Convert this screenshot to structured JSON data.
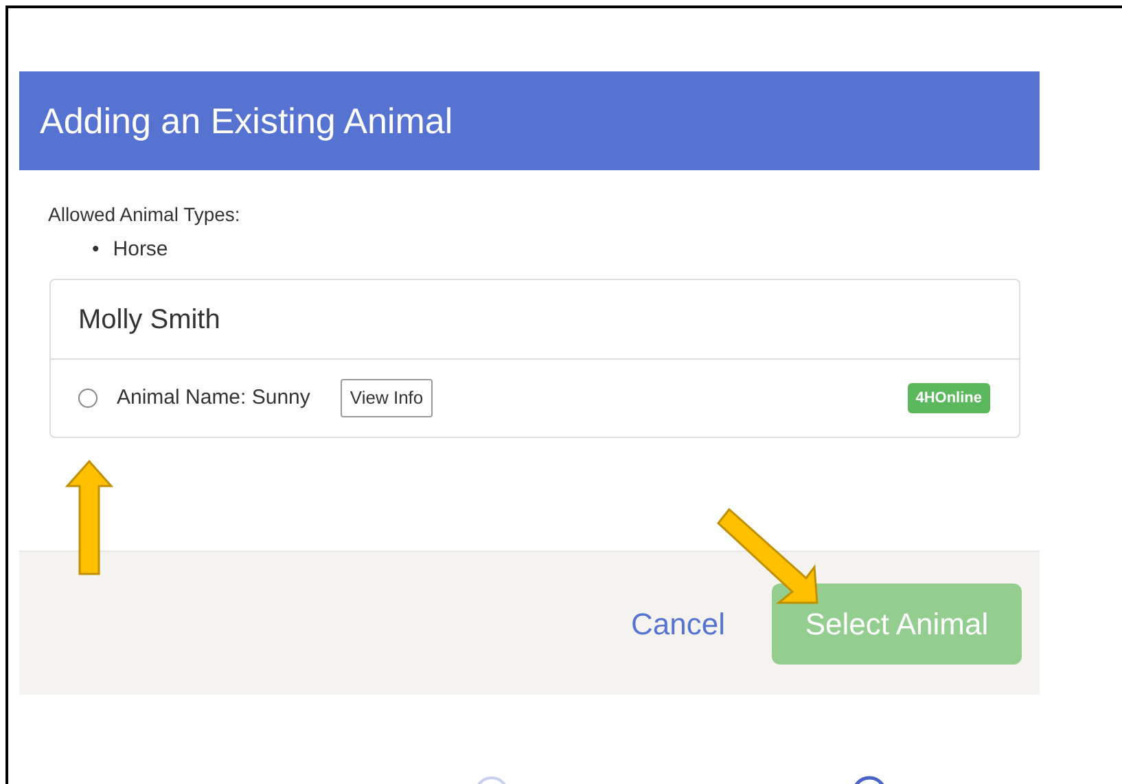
{
  "dialog": {
    "title": "Adding an Existing Animal",
    "allowed_types_label": "Allowed Animal Types:",
    "allowed_types": [
      {
        "bullet": "•",
        "label": "Horse"
      }
    ],
    "owner": {
      "name": "Molly Smith",
      "animals": [
        {
          "label": "Animal Name: Sunny",
          "selected": false,
          "view_button": "View Info",
          "source_badge": "4HOnline"
        }
      ]
    },
    "cancel_link": "Cancel",
    "select_button": {
      "label": "Select Animal",
      "disabled": true
    }
  }
}
